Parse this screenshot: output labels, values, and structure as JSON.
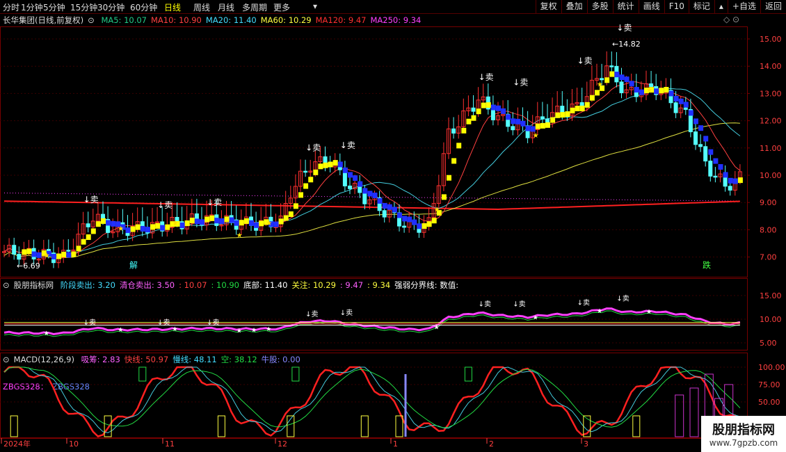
{
  "toolbar": {
    "periods": [
      "分时",
      "1分钟",
      "5分钟",
      "15分钟",
      "30分钟",
      "60分钟",
      "日线",
      "周线",
      "月线",
      "多周期",
      "更多"
    ],
    "active_period": "日线",
    "more_icon": "triangle-down-icon",
    "buttons": [
      "复权",
      "叠加",
      "多股",
      "统计",
      "画线",
      "F10",
      "标记",
      "+自选",
      "返回"
    ],
    "up_icon": "triangle-up-icon"
  },
  "main_info": {
    "title": "长华集团(日线,前复权)",
    "items": [
      {
        "label": "MA5: 10.07",
        "color": "#22cc88"
      },
      {
        "label": "MA10: 10.90",
        "color": "#ff4040"
      },
      {
        "label": "MA20: 11.40",
        "color": "#44ddff"
      },
      {
        "label": "MA60: 10.29",
        "color": "#ffff40"
      },
      {
        "label": "MA120: 9.47",
        "color": "#ff3030"
      },
      {
        "label": "MA250: 9.34",
        "color": "#ff40ff"
      }
    ]
  },
  "main_annotations": {
    "high": "14.82",
    "low": "6.69",
    "sell": "卖",
    "jie": "解",
    "die": "跌"
  },
  "main_axis": [
    "15.00",
    "14.00",
    "13.00",
    "12.00",
    "11.00",
    "10.00",
    "9.00",
    "8.00",
    "7.00"
  ],
  "ind_info": {
    "title": "股朋指标网",
    "items": [
      {
        "label": "阶段卖出: 3.20",
        "color": "#44ddff"
      },
      {
        "label": "清仓卖出: 3.50",
        "color": "#ff60ff"
      },
      {
        "label": ": 10.07",
        "color": "#ff4040"
      },
      {
        "label": ": 10.90",
        "color": "#22dd44"
      },
      {
        "label": "底部: 11.40",
        "color": "#ffffff"
      },
      {
        "label": "关注: 10.29",
        "color": "#ffff40"
      },
      {
        "label": ": 9.47",
        "color": "#ff60ff"
      },
      {
        "label": ": 9.34",
        "color": "#ffff40"
      },
      {
        "label": "强弱分界线: 数值:",
        "color": "#ffffff"
      }
    ]
  },
  "ind_axis": [
    "15.00",
    "10.00",
    "5.00"
  ],
  "macd_info": {
    "title": "MACD(12,26,9)",
    "items": [
      {
        "label": "吸筹: 2.83",
        "color": "#ff60ff"
      },
      {
        "label": "快线: 50.97",
        "color": "#ff4040"
      },
      {
        "label": "慢线: 48.11",
        "color": "#44ddff"
      },
      {
        "label": "空: 38.12",
        "color": "#22dd44"
      },
      {
        "label": "牛股: 0.00",
        "color": "#8888ff"
      }
    ],
    "zbgs": "ZBGS328：",
    "zbgs2": "ZBGS328"
  },
  "macd_axis": [
    "100.00",
    "75.00",
    "50.00"
  ],
  "dates": [
    "2024年",
    "10",
    "11",
    "12",
    "1",
    "2",
    "3"
  ],
  "watermark": {
    "line1": "股朋指标网",
    "line2": "www.7gpzb.com"
  },
  "colors": {
    "up": "#ff3030",
    "down": "#54ffff",
    "bg": "#000000",
    "frame": "#770000"
  }
}
